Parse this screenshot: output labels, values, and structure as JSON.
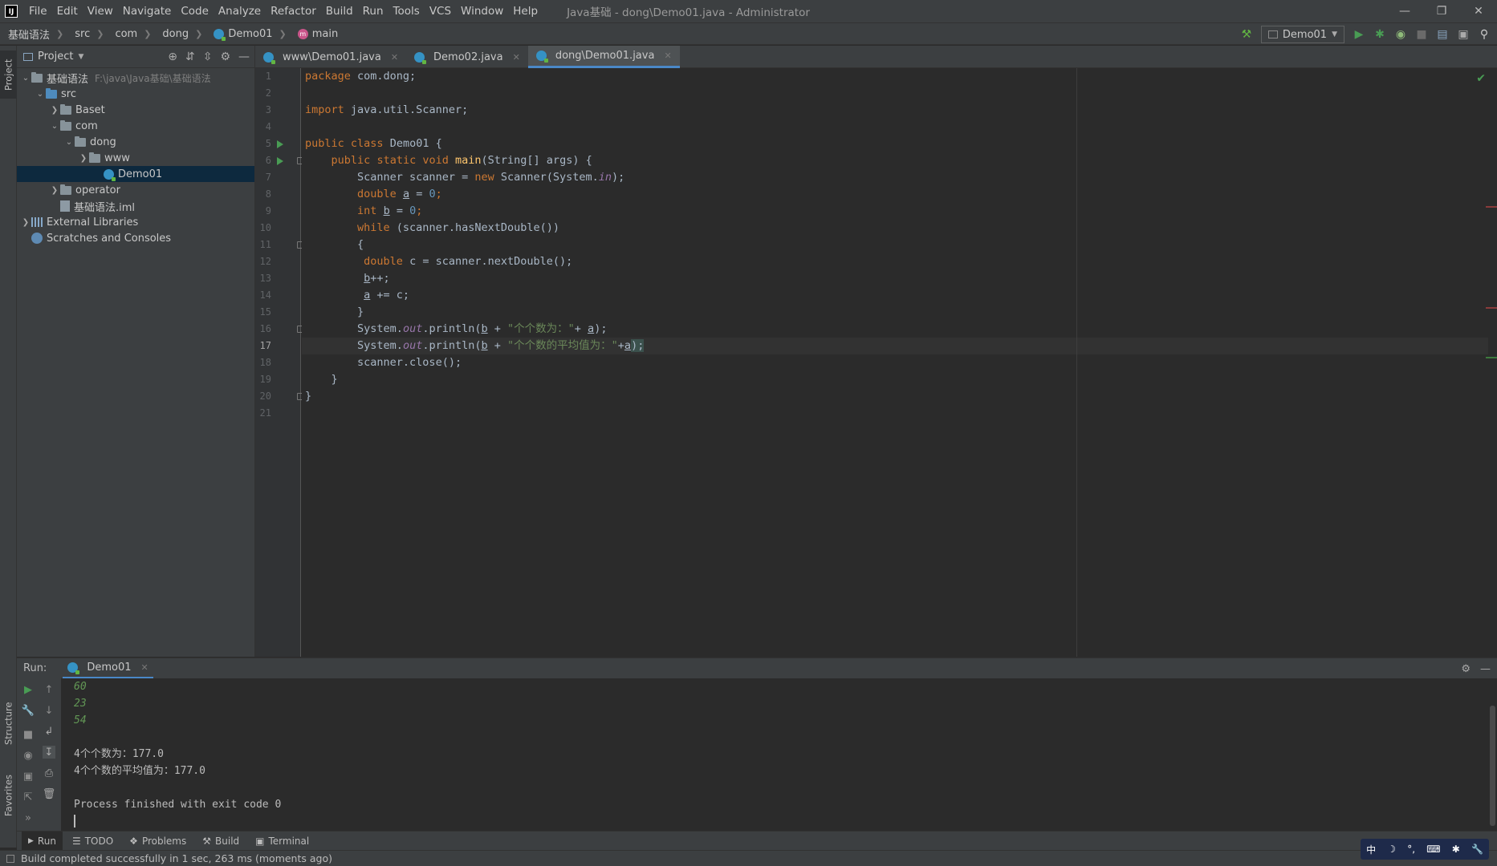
{
  "window": {
    "title": "Java基础 - dong\\Demo01.java - Administrator",
    "logo": "IJ"
  },
  "menu": [
    "File",
    "Edit",
    "View",
    "Navigate",
    "Code",
    "Analyze",
    "Refactor",
    "Build",
    "Run",
    "Tools",
    "VCS",
    "Window",
    "Help"
  ],
  "breadcrumb": [
    "基础语法",
    "src",
    "com",
    "dong",
    "Demo01",
    "main"
  ],
  "run_config": "Demo01",
  "project_panel": {
    "title": "Project",
    "tree": [
      {
        "label": "基础语法",
        "path": "F:\\java\\Java基础\\基础语法"
      },
      {
        "label": "src"
      },
      {
        "label": "Baset"
      },
      {
        "label": "com"
      },
      {
        "label": "dong"
      },
      {
        "label": "www"
      },
      {
        "label": "Demo01"
      },
      {
        "label": "operator"
      },
      {
        "label": "基础语法.iml"
      },
      {
        "label": "External Libraries"
      },
      {
        "label": "Scratches and Consoles"
      }
    ]
  },
  "editor_tabs": [
    {
      "label": "www\\Demo01.java"
    },
    {
      "label": "Demo02.java"
    },
    {
      "label": "dong\\Demo01.java"
    }
  ],
  "code": {
    "line_numbers": [
      "1",
      "2",
      "3",
      "4",
      "5",
      "6",
      "7",
      "8",
      "9",
      "10",
      "11",
      "12",
      "13",
      "14",
      "15",
      "16",
      "17",
      "18",
      "19",
      "20",
      "21"
    ],
    "current_line": 17,
    "tokens": {
      "package": "package",
      "pkg_name": " com.dong;",
      "import": "import",
      "import_name": " java.util.Scanner;",
      "public": "public",
      "class": "class",
      "class_name": " Demo01 {",
      "static": "static",
      "void": "void",
      "main": "main",
      "main_args": "(String[] args) {",
      "scanner_decl": "Scanner scanner = ",
      "new": "new",
      "scanner_ctor": " Scanner(System.",
      "in": "in",
      "close_paren_semi": ");",
      "double": "double",
      "int": "int",
      "var_a": "a",
      "var_b": "b",
      "var_c": "c",
      "assign": " = ",
      "zero": "0",
      "semi": ";",
      "while": "while",
      "while_cond": " (scanner.hasNextDouble())",
      "brace_open": "{",
      "brace_close": "}",
      "next_double": " = scanner.nextDouble();",
      "inc": "++;",
      "plus_assign": " += c;",
      "system": "System.",
      "out": "out",
      "println": ".println(",
      "plus": " + ",
      "str1": "\"个个数为：\"",
      "plus_a": "+ ",
      "str2": "\"个个数的平均值为：\"",
      "plus_a2": "+",
      "scanner_close": "scanner.close();"
    }
  },
  "run_panel": {
    "label": "Run:",
    "tab": "Demo01",
    "console": [
      {
        "text": "60",
        "kind": "input"
      },
      {
        "text": "23",
        "kind": "input"
      },
      {
        "text": "54",
        "kind": "input"
      },
      {
        "text": "4个个数为：177.0",
        "kind": "output"
      },
      {
        "text": "4个个数的平均值为：177.0",
        "kind": "output"
      },
      {
        "text": "Process finished with exit code 0",
        "kind": "output"
      }
    ]
  },
  "bottom_tabs": [
    "Run",
    "TODO",
    "Problems",
    "Build",
    "Terminal"
  ],
  "left_strip": [
    "Project",
    "Structure",
    "Favorites"
  ],
  "status": "Build completed successfully in 1 sec, 263 ms (moments ago)",
  "ime": [
    "中",
    "☽",
    "°,",
    "⌨",
    "✱",
    "🔧"
  ],
  "colors": {
    "keyword": "#cc7832",
    "string": "#6a8759",
    "number": "#6897bb",
    "function": "#ffc66d",
    "field": "#9876aa",
    "accent": "#4a88c7",
    "run_green": "#499c54"
  }
}
